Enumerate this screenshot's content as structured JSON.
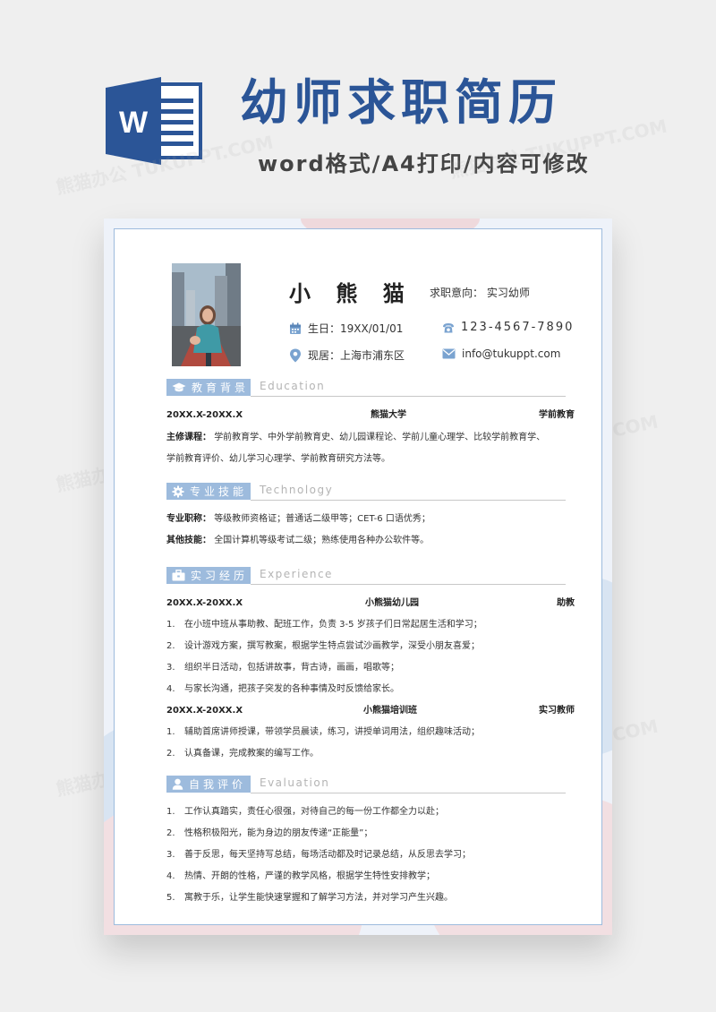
{
  "banner": {
    "icon_letter": "W",
    "title": "幼师求职简历",
    "subtitle": "word格式/A4打印/内容可修改"
  },
  "resume": {
    "name": "小 熊 猫",
    "intent_label": "求职意向：",
    "intent_value": "实习幼师",
    "birth_label": "生日：",
    "birth_value": "19XX/01/01",
    "phone": "123-4567-7890",
    "address_label": "现居：",
    "address_value": "上海市浦东区",
    "email": "info@tukuppt.com"
  },
  "education": {
    "label": "教育背景",
    "label_en": "Education",
    "period": "20XX.X-20XX.X",
    "school": "熊猫大学",
    "major": "学前教育",
    "courses_label": "主修课程：",
    "courses_line1": "学前教育学、中外学前教育史、幼儿园课程论、学前儿童心理学、比较学前教育学、",
    "courses_line2": "学前教育评价、幼儿学习心理学、学前教育研究方法等。"
  },
  "skills": {
    "label": "专业技能",
    "label_en": "Technology",
    "cert_label": "专业职称：",
    "cert_value": "等级教师资格证；普通话二级甲等；CET-6 口语优秀；",
    "other_label": "其他技能：",
    "other_value": "全国计算机等级考试二级；熟练使用各种办公软件等。"
  },
  "experience": {
    "label": "实习经历",
    "label_en": "Experience",
    "jobs": [
      {
        "period": "20XX.X-20XX.X",
        "org": "小熊猫幼儿园",
        "role": "助教",
        "items": [
          {
            "num": "1.",
            "text": "在小班中班从事助教、配班工作，负责 3-5 岁孩子们日常起居生活和学习；"
          },
          {
            "num": "2.",
            "text": "设计游戏方案，撰写教案，根据学生特点尝试沙画教学，深受小朋友喜爱；"
          },
          {
            "num": "3.",
            "text": "组织半日活动，包括讲故事，背古诗，画画，唱歌等；"
          },
          {
            "num": "4.",
            "text": "与家长沟通，把孩子突发的各种事情及时反馈给家长。"
          }
        ]
      },
      {
        "period": "20XX.X-20XX.X",
        "org": "小熊猫培训班",
        "role": "实习教师",
        "items": [
          {
            "num": "1.",
            "text": "辅助首席讲师授课，带领学员晨读，练习，讲授单词用法，组织趣味活动；"
          },
          {
            "num": "2.",
            "text": "认真备课，完成教案的编写工作。"
          }
        ]
      }
    ]
  },
  "evaluation": {
    "label": "自我评价",
    "label_en": "Evaluation",
    "items": [
      {
        "num": "1.",
        "text": "工作认真踏实，责任心很强，对待自己的每一份工作都全力以赴；"
      },
      {
        "num": "2.",
        "text": "性格积极阳光，能为身边的朋友传递“正能量”；"
      },
      {
        "num": "3.",
        "text": "善于反思，每天坚持写总结，每场活动都及时记录总结，从反思去学习；"
      },
      {
        "num": "4.",
        "text": "热情、开朗的性格，严谨的教学风格，根据学生特性安排教学；"
      },
      {
        "num": "5.",
        "text": "寓教于乐，让学生能快速掌握和了解学习方法，并对学习产生兴趣。"
      }
    ]
  },
  "watermark": "熊猫办公 TUKUPPT.COM",
  "colors": {
    "brand_blue": "#2b5597",
    "accent_blue": "#9dbbdd",
    "pink": "#f2dfe2"
  },
  "icons": [
    "word-icon",
    "calendar-icon",
    "phone-icon",
    "location-icon",
    "email-icon",
    "graduation-cap-icon",
    "gear-icon",
    "briefcase-icon",
    "person-icon"
  ]
}
